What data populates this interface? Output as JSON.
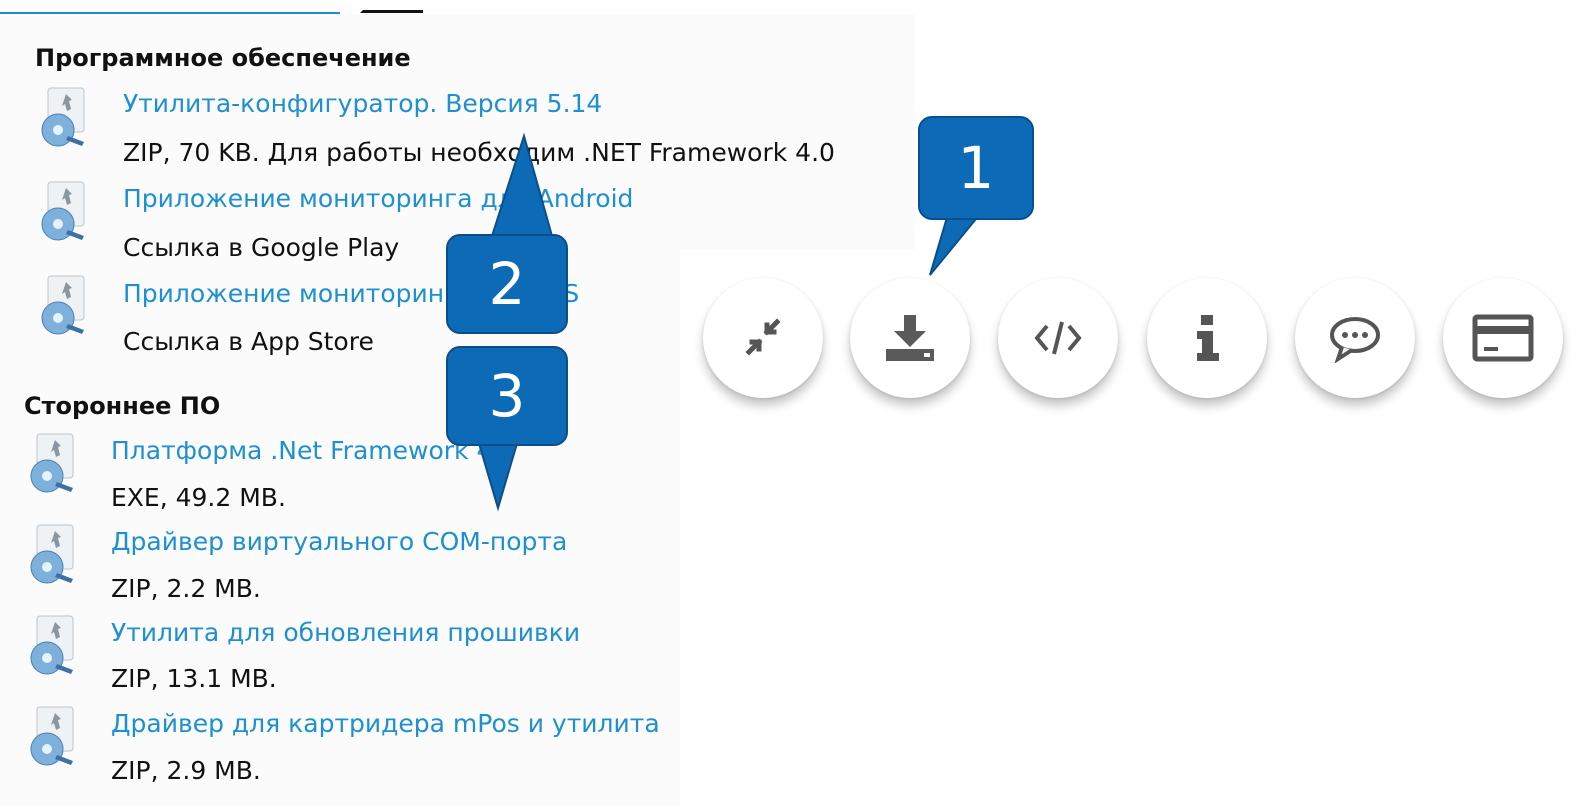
{
  "sections": [
    {
      "title": "Программное обеспечение",
      "items": [
        {
          "title": "Утилита-конфигуратор. Версия 5.14",
          "desc": "ZIP, 70 KB. Для работы необходим .NET Framework 4.0"
        },
        {
          "title": "Приложение мониторинга для Android",
          "desc": "Ссылка в Google Play"
        },
        {
          "title": "Приложение мониторинга для iOS",
          "desc": "Ссылка в App Store"
        }
      ]
    },
    {
      "title": "Стороннее ПО",
      "items": [
        {
          "title": "Платформа .Net Framework 4.0",
          "desc": "EXE, 49.2 MB."
        },
        {
          "title": "Драйвер виртуального COM-порта",
          "desc": "ZIP, 2.2 MB."
        },
        {
          "title": "Утилита для обновления прошивки",
          "desc": "ZIP, 13.1 MB."
        },
        {
          "title": "Драйвер для картридера mPos и утилита",
          "desc": "ZIP, 2.9 MB."
        }
      ]
    }
  ],
  "toolbar": {
    "buttons": [
      {
        "icon": "collapse-arrows-icon"
      },
      {
        "icon": "download-icon"
      },
      {
        "icon": "code-icon"
      },
      {
        "icon": "info-icon"
      },
      {
        "icon": "comment-icon"
      },
      {
        "icon": "card-icon"
      }
    ]
  },
  "callouts": [
    {
      "label": "1"
    },
    {
      "label": "2"
    },
    {
      "label": "3"
    }
  ],
  "colors": {
    "link": "#1e8fd0",
    "callout": "#0d6ab6",
    "text": "#111111"
  }
}
